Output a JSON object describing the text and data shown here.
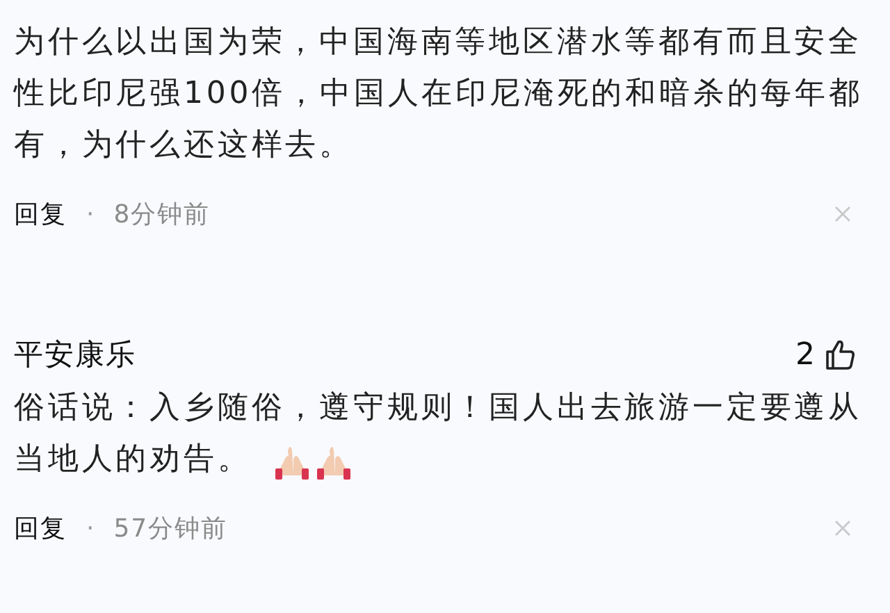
{
  "comments": [
    {
      "text_lines": [
        "为什么以出国为荣，中国海南等地区潜水等都有而且安全",
        "性比印尼强100倍，中国人在印尼淹死的和暗杀的每年都",
        "有，为什么还这样去。"
      ],
      "reply_label": "回复",
      "separator": "·",
      "time": "8分钟前"
    },
    {
      "username": "平安康乐",
      "likes": "2",
      "text_lines": [
        "俗话说：入乡随俗，遵守规则！国人出去旅游一定要遵从",
        "当地人的劝告。"
      ],
      "icons": [
        {
          "kind": "praying-hands"
        },
        {
          "kind": "praying-hands"
        }
      ],
      "reply_label": "回复",
      "separator": "·",
      "time": "57分钟前"
    }
  ]
}
